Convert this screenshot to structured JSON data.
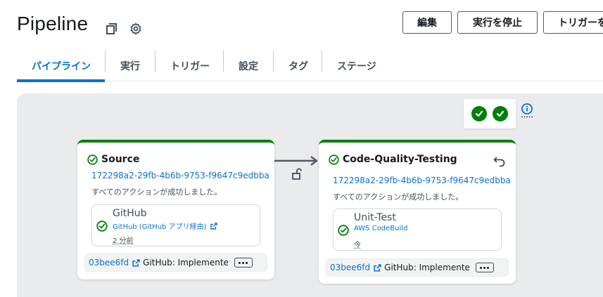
{
  "header": {
    "title": "Pipeline",
    "icons": [
      "copy-icon",
      "gear-icon"
    ],
    "buttons": {
      "edit": "編集",
      "stop": "実行を停止",
      "trigger": "トリガーを"
    }
  },
  "tabs": [
    {
      "label": "パイプライン",
      "active": true
    },
    {
      "label": "実行",
      "active": false
    },
    {
      "label": "トリガー",
      "active": false
    },
    {
      "label": "設定",
      "active": false
    },
    {
      "label": "タグ",
      "active": false
    },
    {
      "label": "ステージ",
      "active": false
    }
  ],
  "colors": {
    "success": "#037f0c",
    "link": "#0972d3",
    "canvas": "#e9ebed"
  },
  "stages": [
    {
      "name": "Source",
      "execution_id": "172298a2-29fb-4b6b-9753-f9647c9edbba",
      "message": "すべてのアクションが成功しました。",
      "action": {
        "name": "GitHub",
        "provider": "GitHub (GitHub アプリ経由)",
        "time": "2 分前"
      },
      "revision": {
        "id": "03bee6fd",
        "message": "GitHub: Implemente"
      }
    },
    {
      "name": "Code-Quality-Testing",
      "execution_id": "172298a2-29fb-4b6b-9753-f9647c9edbba",
      "message": "すべてのアクションが成功しました。",
      "action": {
        "name": "Unit-Test",
        "provider": "AWS CodeBuild",
        "time": "今"
      },
      "revision": {
        "id": "03bee6fd",
        "message": "GitHub: Implemente"
      }
    }
  ]
}
